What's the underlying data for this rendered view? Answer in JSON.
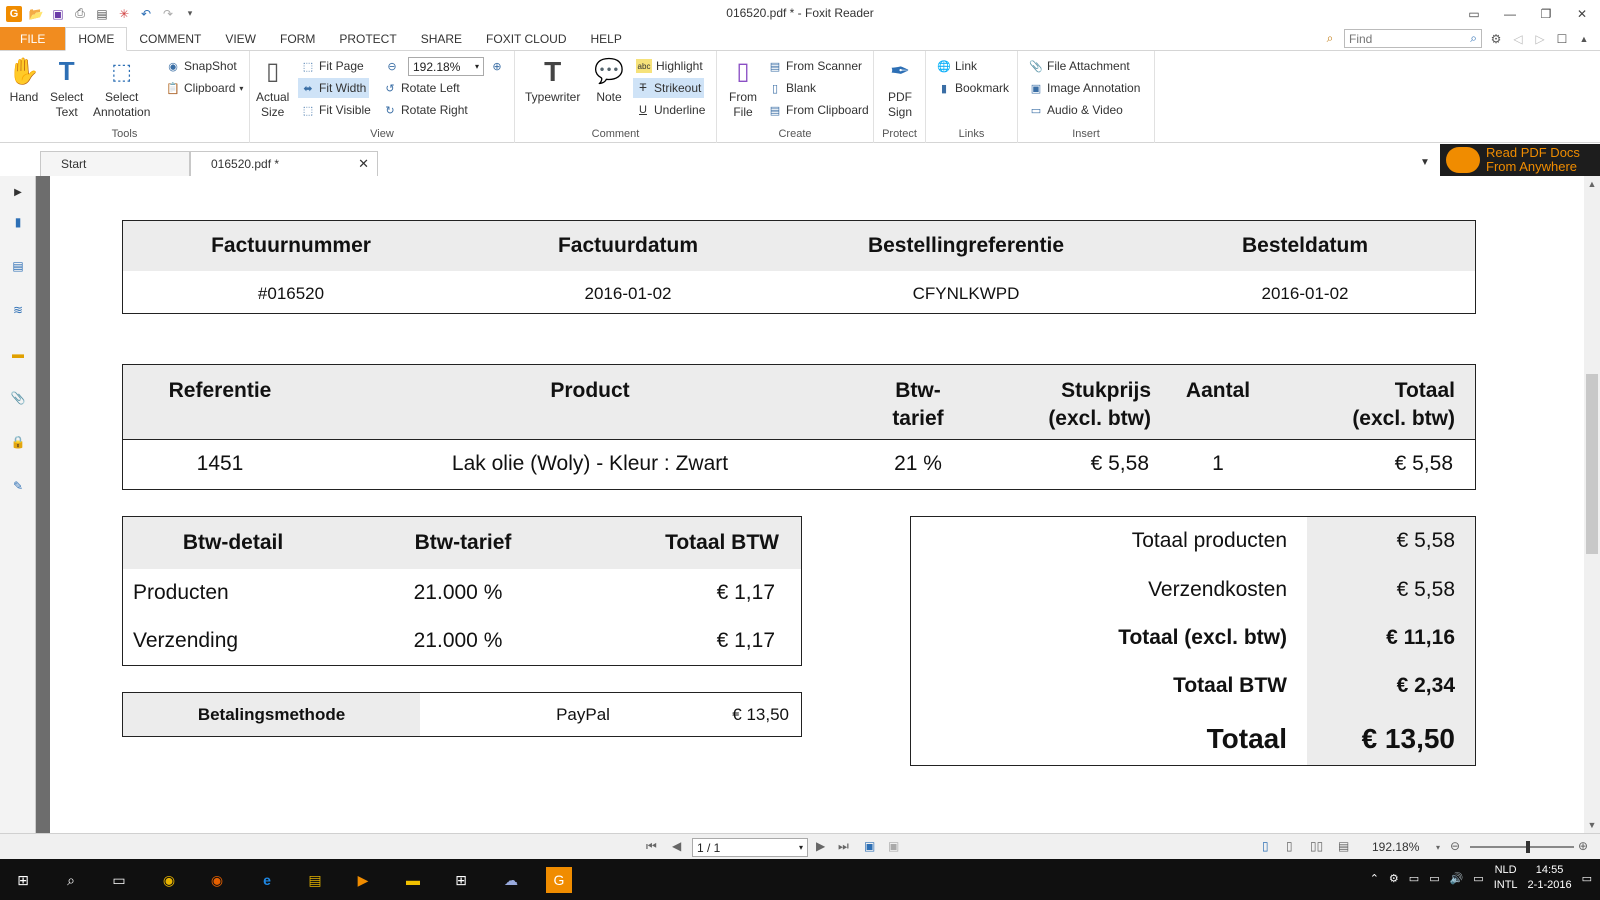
{
  "window": {
    "title": "016520.pdf * - Foxit Reader",
    "controls": [
      "▭",
      "—",
      "❐",
      "✕"
    ]
  },
  "ribbon_tabs": [
    "FILE",
    "HOME",
    "COMMENT",
    "VIEW",
    "FORM",
    "PROTECT",
    "SHARE",
    "FOXIT CLOUD",
    "HELP"
  ],
  "find": {
    "placeholder": "Find"
  },
  "ribbon": {
    "tools": {
      "hand": "Hand",
      "select_text_1": "Select",
      "select_text_2": "Text",
      "select_annotation_1": "Select",
      "select_annotation_2": "Annotation",
      "snapshot": "SnapShot",
      "clipboard": "Clipboard",
      "label": "Tools"
    },
    "view": {
      "actual_size_1": "Actual",
      "actual_size_2": "Size",
      "fit_page": "Fit Page",
      "fit_width": "Fit Width",
      "fit_visible": "Fit Visible",
      "zoom_value": "192.18%",
      "rotate_left": "Rotate Left",
      "rotate_right": "Rotate Right",
      "label": "View"
    },
    "comment": {
      "typewriter": "Typewriter",
      "note": "Note",
      "highlight": "Highlight",
      "strikeout": "Strikeout",
      "underline": "Underline",
      "label": "Comment"
    },
    "create": {
      "from_file_1": "From",
      "from_file_2": "File",
      "from_scanner": "From Scanner",
      "blank": "Blank",
      "from_clipboard": "From Clipboard",
      "label": "Create"
    },
    "protect": {
      "pdf_sign_1": "PDF",
      "pdf_sign_2": "Sign",
      "label": "Protect"
    },
    "links": {
      "link": "Link",
      "bookmark": "Bookmark",
      "label": "Links"
    },
    "insert": {
      "file_attachment": "File Attachment",
      "image_annotation": "Image Annotation",
      "audio_video": "Audio & Video",
      "label": "Insert"
    }
  },
  "doc_tabs": [
    "Start",
    "016520.pdf *"
  ],
  "promo": {
    "line1": "Read PDF Docs",
    "line2": "From Anywhere"
  },
  "invoice": {
    "header": {
      "columns": [
        "Factuurnummer",
        "Factuurdatum",
        "Bestellingreferentie",
        "Besteldatum"
      ],
      "values": [
        "#016520",
        "2016-01-02",
        "CFYNLKWPD",
        "2016-01-02"
      ]
    },
    "items": {
      "columns": {
        "ref": "Referentie",
        "product": "Product",
        "btw_1": "Btw-",
        "btw_2": "tarief",
        "price_1": "Stukprijs",
        "price_2": "(excl. btw)",
        "qty": "Aantal",
        "total_1": "Totaal",
        "total_2": "(excl. btw)"
      },
      "rows": [
        {
          "ref": "1451",
          "product": "Lak olie (Woly) - Kleur : Zwart",
          "btw": "21 %",
          "price": "€ 5,58",
          "qty": "1",
          "total": "€ 5,58"
        }
      ]
    },
    "vat": {
      "columns": [
        "Btw-detail",
        "Btw-tarief",
        "Totaal BTW"
      ],
      "rows": [
        {
          "detail": "Producten",
          "rate": "21.000 %",
          "total": "€ 1,17"
        },
        {
          "detail": "Verzending",
          "rate": "21.000 %",
          "total": "€ 1,17"
        }
      ]
    },
    "payment": {
      "label": "Betalingsmethode",
      "method": "PayPal",
      "amount": "€ 13,50"
    },
    "totals": [
      {
        "label": "Totaal producten",
        "value": "€ 5,58"
      },
      {
        "label": "Verzendkosten",
        "value": "€ 5,58"
      },
      {
        "label": "Totaal (excl. btw)",
        "value": "€ 11,16"
      },
      {
        "label": "Totaal BTW",
        "value": "€ 2,34"
      },
      {
        "label": "Totaal",
        "value": "€ 13,50"
      }
    ]
  },
  "status": {
    "page": "1 / 1",
    "zoom": "192.18%"
  },
  "taskbar": {
    "lang_1": "NLD",
    "lang_2": "INTL",
    "time": "14:55",
    "date": "2-1-2016"
  }
}
